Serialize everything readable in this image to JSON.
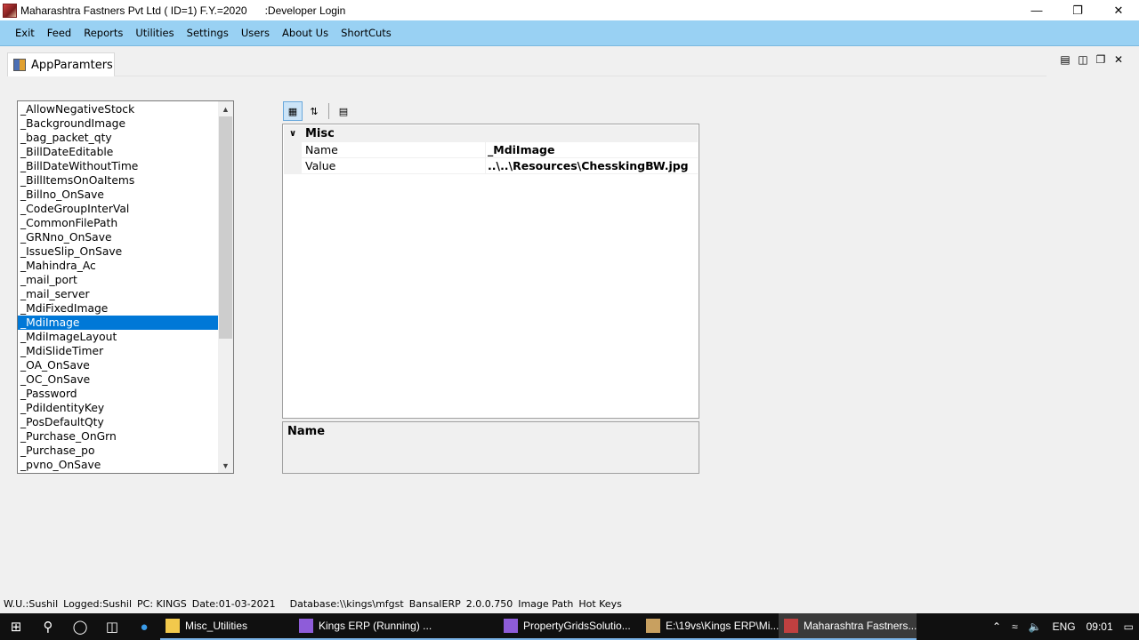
{
  "window": {
    "title": "Maharashtra Fastners Pvt Ltd ( ID=1) F.Y.=2020      :Developer Login"
  },
  "menu": [
    "Exit",
    "Feed",
    "Reports",
    "Utilities",
    "Settings",
    "Users",
    "About Us",
    "ShortCuts"
  ],
  "tab": {
    "label": "AppParamters"
  },
  "list": {
    "items": [
      "_AllowNegativeStock",
      "_BackgroundImage",
      "_bag_packet_qty",
      "_BillDateEditable",
      "_BillDateWithoutTime",
      "_BillItemsOnOaItems",
      "_Billno_OnSave",
      "_CodeGroupInterVal",
      "_CommonFilePath",
      "_GRNno_OnSave",
      "_IssueSlip_OnSave",
      "_Mahindra_Ac",
      "_mail_port",
      "_mail_server",
      "_MdiFixedImage",
      "_MdiImage",
      "_MdiImageLayout",
      "_MdiSlideTimer",
      "_OA_OnSave",
      "_OC_OnSave",
      "_Password",
      "_PdiIdentityKey",
      "_PosDefaultQty",
      "_Purchase_OnGrn",
      "_Purchase_po",
      "_pvno_OnSave"
    ],
    "selected": "_MdiImage"
  },
  "property_grid": {
    "category": "Misc",
    "rows": [
      {
        "name": "Name",
        "value": "_MdiImage"
      },
      {
        "name": "Value",
        "value": "..\\..\\Resources\\ChesskingBW.jpg"
      }
    ],
    "description_title": "Name"
  },
  "statusbar": {
    "user": "W.U.:Sushil",
    "logged": "Logged:Sushil",
    "pc": "PC: KINGS",
    "date": "Date:01-03-2021",
    "database": "Database:\\\\kings\\mfgst",
    "erp": "BansalERP",
    "version": "2.0.0.750",
    "image_path": "Image Path",
    "hot_keys": "Hot Keys"
  },
  "taskbar": {
    "tasks": [
      {
        "label": "Misc_Utilities",
        "color": "#f2c94c"
      },
      {
        "label": "Kings ERP (Running) ...",
        "color": "#8e5cd9"
      },
      {
        "label": "PropertyGridsSolutio...",
        "color": "#8e5cd9"
      },
      {
        "label": "E:\\19vs\\Kings ERP\\Mi...",
        "color": "#c8a060"
      },
      {
        "label": "Maharashtra Fastners...",
        "color": "#c04040"
      }
    ],
    "lang": "ENG",
    "time": "09:01"
  }
}
